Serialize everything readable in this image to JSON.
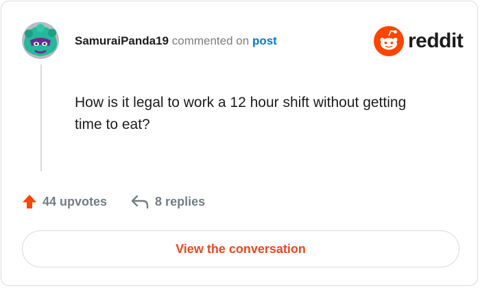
{
  "comment": {
    "username": "SamuraiPanda19",
    "action_text": "commented on",
    "target_link": "post",
    "body": "How is it legal to work a 12 hour shift without getting time to eat?"
  },
  "brand": {
    "wordmark": "reddit",
    "icon": "reddit-logo-icon",
    "color": "#ff4500"
  },
  "stats": {
    "upvotes_label": "44 upvotes",
    "replies_label": "8 replies",
    "upvote_icon": "upvote-arrow-icon",
    "reply_icon": "reply-arrow-icon"
  },
  "cta": {
    "label": "View the conversation"
  },
  "colors": {
    "accent": "#ff4500",
    "link": "#0079d3",
    "cta_text": "#e8491d"
  }
}
